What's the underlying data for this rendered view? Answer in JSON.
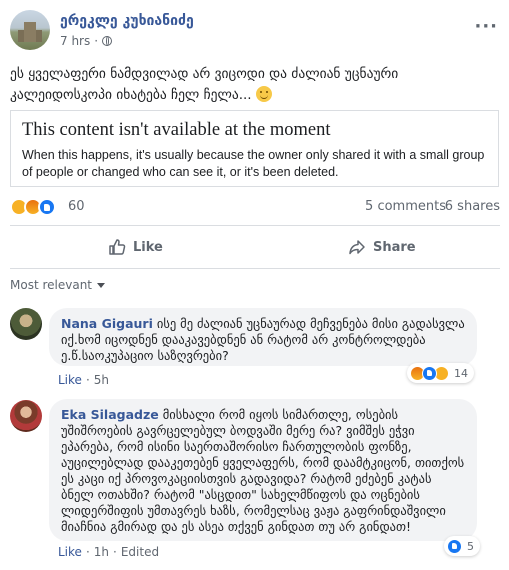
{
  "post": {
    "author": "ერეკლე კუხიანიძე",
    "time": "7 hrs",
    "text": "ეს ყველაფერი ნამდვილად არ ვიცოდი და ძალიან უცნაური კალეიდოსკოპი იხატება ჩელ ჩელა...",
    "more_icon": "more-options-icon"
  },
  "unavailable": {
    "title": "This content isn't available at the moment",
    "description": "When this happens, it's usually because the owner only shared it with a small group of people or changed who can see it, or it's been deleted."
  },
  "stats": {
    "reactions_count": "60",
    "comments": "5 comments",
    "shares": "6 shares"
  },
  "actions": {
    "like": "Like",
    "share": "Share"
  },
  "filter": {
    "label": "Most relevant"
  },
  "comments": [
    {
      "name": "Nana Gigauri",
      "text": "ისე მე ძალიან უცნაურად მეჩვენება მისი გადასვლა იქ.ხომ იცოდნენ დააკავებდნენ ან რატომ არ კონტროლდება ე.წ.საოკუპაციო საზღვრები?",
      "like": "Like",
      "time": "5h",
      "reactions": "14"
    },
    {
      "name": "Eka Silagadze",
      "text": "მისხალი რომ იყოს სიმართლე, ოსების უშიშროების გავრცელებულ ბოდვაში მერე რა? ვიმშეს ეჭვი ეპარება, რომ ისინი საერთაშორისო ჩართულობის ფონზე, აუცილებლად დააკეთებენ ყველაფერს, რომ დაამტკიცონ, თითქოს ეს კაცი იქ პროვოკაციისთვის გადავიდა? რატომ ეძებენ კატას ბნელ ოთახში? რატომ \"ასცდით\" სახელმწიფოს და ოცნების ლიდერშიფის უმთავრეს ხაზს, რომელსაც ვაჟა გაფრინდაშვილი მიაჩნია გმირად და ეს ასეა თქვენ გინდათ თუ არ გინდათ!",
      "like": "Like",
      "time": "1h",
      "edited": "Edited",
      "reactions": "5"
    }
  ]
}
